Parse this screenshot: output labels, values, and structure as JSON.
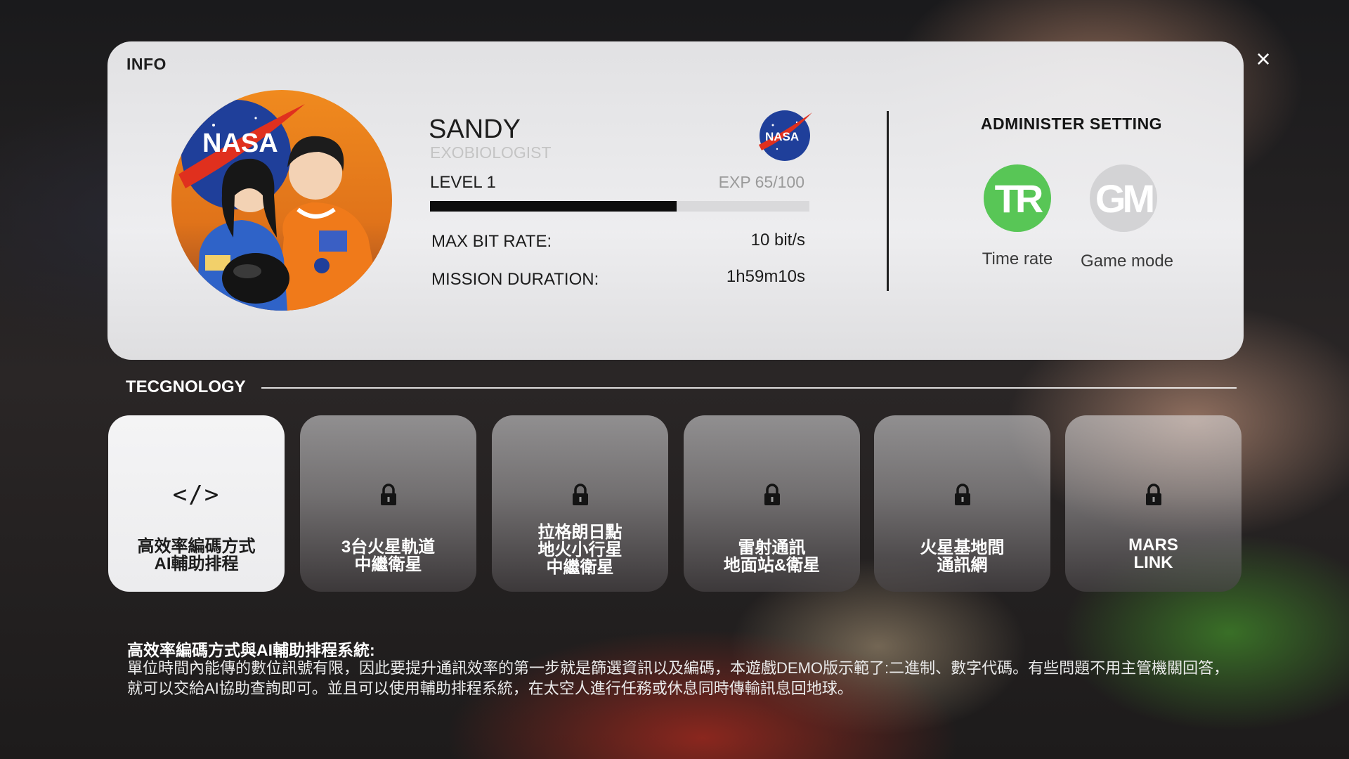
{
  "info": {
    "title": "INFO",
    "close_label": "×"
  },
  "profile": {
    "name": "SANDY",
    "role": "EXOBIOLOGIST",
    "level_label": "LEVEL 1",
    "exp_label": "EXP 65/100",
    "exp_fraction": 0.65,
    "stats": [
      {
        "label": "MAX BIT RATE:",
        "value": "10 bit/s"
      },
      {
        "label": "MISSION DURATION:",
        "value": "1h59m10s"
      }
    ],
    "avatar_logo_text": "NASA",
    "logo_text": "NASA"
  },
  "admin": {
    "title": "ADMINISTER SETTING",
    "buttons": [
      {
        "abbr": "TR",
        "label": "Time rate",
        "color": "#58c656"
      },
      {
        "abbr": "GM",
        "label": "Game mode",
        "color": "#d3d3d5"
      }
    ]
  },
  "technology": {
    "title": "TECGNOLOGY",
    "cards": [
      {
        "label": "高效率編碼方式\nAI輔助排程",
        "icon": "code-icon",
        "icon_text": "</>",
        "locked": false
      },
      {
        "label": "3台火星軌道\n中繼衛星",
        "icon": "lock-icon",
        "locked": true
      },
      {
        "label": "拉格朗日點\n地火小行星\n中繼衛星",
        "icon": "lock-icon",
        "locked": true
      },
      {
        "label": "雷射通訊\n地面站&衛星",
        "icon": "lock-icon",
        "locked": true
      },
      {
        "label": "火星基地間\n通訊網",
        "icon": "lock-icon",
        "locked": true
      },
      {
        "label": "MARS\nLINK",
        "icon": "lock-icon",
        "locked": true
      }
    ]
  },
  "description": {
    "title": "高效率編碼方式與AI輔助排程系統:",
    "body": "單位時間內能傳的數位訊號有限，因此要提升通訊效率的第一步就是篩選資訊以及編碼，本遊戲DEMO版示範了:二進制、數字代碼。有些問題不用主管機關回答，就可以交給AI協助查詢即可。並且可以使用輔助排程系統，在太空人進行任務或休息同時傳輸訊息回地球。"
  },
  "colors": {
    "accent_green": "#58c656",
    "exp_fill": "#0d0d0d"
  }
}
